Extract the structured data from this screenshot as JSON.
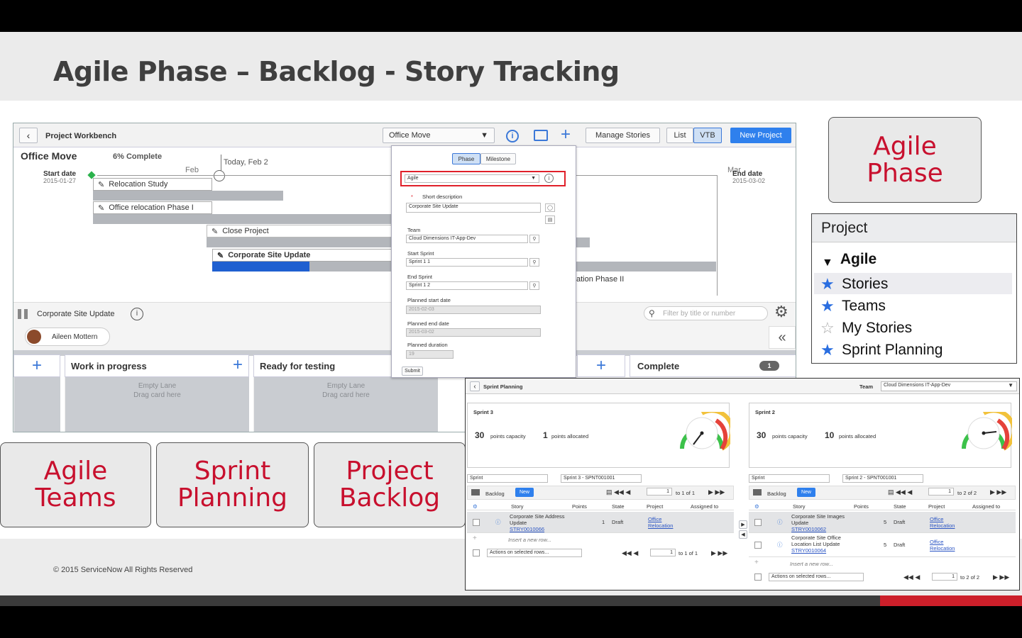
{
  "slide": {
    "title": "Agile Phase – Backlog - Story Tracking",
    "copyright": "© 2015 ServiceNow All Rights Reserved"
  },
  "workbench": {
    "header": "Project Workbench",
    "project_select": "Office Move",
    "buttons": {
      "manage": "Manage Stories",
      "list": "List",
      "vtb": "VTB",
      "new_project": "New Project"
    },
    "project_name": "Office Move",
    "complete": "6% Complete",
    "today": "Today, Feb 2",
    "month_feb": "Feb",
    "month_mar": "Mar",
    "start_label": "Start date",
    "start_value": "2015-01-27",
    "end_label": "End date",
    "end_value": "2015-03-02",
    "tasks": [
      "Relocation Study",
      "Office relocation Phase I",
      "Close Project",
      "Corporate Site Update"
    ],
    "phase2": "ation Phase II",
    "lane_header": "Corporate Site Update",
    "filter_placeholder": "Filter by title or number",
    "user": "Aileen Mottern",
    "lanes": {
      "wip": "Work in progress",
      "ready": "Ready for testing",
      "complete": "Complete",
      "complete_count": "1",
      "empty1": "Empty Lane",
      "empty2": "Drag card here"
    }
  },
  "form": {
    "tab_phase": "Phase",
    "tab_milestone": "Milestone",
    "phase_value": "Agile",
    "short_desc_label": "Short description",
    "short_desc": "Corporate Site Update",
    "team_label": "Team",
    "team": "Cloud Dimensions IT-App-Dev",
    "start_sprint_label": "Start Sprint",
    "start_sprint": "Sprint 1 1",
    "end_sprint_label": "End Sprint",
    "end_sprint": "Sprint 1 2",
    "planned_start_label": "Planned start date",
    "planned_start": "2015-02-03",
    "planned_end_label": "Planned end date",
    "planned_end": "2015-03-02",
    "planned_duration_label": "Planned duration",
    "planned_duration": "19",
    "submit": "Submit"
  },
  "boxes": {
    "agile_phase_1": "Agile",
    "agile_phase_2": "Phase",
    "agile_teams_1": "Agile",
    "agile_teams_2": "Teams",
    "sprint_planning_1": "Sprint",
    "sprint_planning_2": "Planning",
    "project_backlog_1": "Project",
    "project_backlog_2": "Backlog"
  },
  "nav": {
    "header": "Project",
    "group": "Agile",
    "items": [
      "Stories",
      "Teams",
      "My Stories",
      "Sprint Planning"
    ]
  },
  "sprint_planning": {
    "title": "Sprint Planning",
    "team_label": "Team",
    "team_value": "Cloud Dimensions IT-App-Dev",
    "sprints": [
      {
        "name": "Sprint 3",
        "capacity": "30",
        "capacity_label": "points capacity",
        "allocated": "1",
        "allocated_label": "points allocated",
        "filter1": "Sprint",
        "filter2": "Sprint 3 - SPNT001001",
        "backlog": "Backlog",
        "new": "New",
        "paging": "to 1 of 1",
        "page": "1",
        "columns": [
          "Story",
          "Points",
          "State",
          "Project",
          "Assigned to"
        ],
        "rows": [
          {
            "story": "Corporate Site Address Update",
            "number": "STRY0010066",
            "points": "1",
            "state": "Draft",
            "project": "Office Relocation"
          }
        ],
        "insert": "Insert a new row...",
        "actions": "Actions on selected rows...",
        "footer_paging": "to 1 of 1"
      },
      {
        "name": "Sprint 2",
        "capacity": "30",
        "capacity_label": "points capacity",
        "allocated": "10",
        "allocated_label": "points allocated",
        "filter1": "Sprint",
        "filter2": "Sprint 2 - SPNT001001",
        "backlog": "Backlog",
        "new": "New",
        "paging": "to 2 of 2",
        "page": "1",
        "columns": [
          "Story",
          "Points",
          "State",
          "Project",
          "Assigned to"
        ],
        "rows": [
          {
            "story": "Corporate Site Images Update",
            "number": "STRY0010062",
            "points": "5",
            "state": "Draft",
            "project": "Office Relocation"
          },
          {
            "story": "Corporate Site Office Location List Update",
            "number": "STRY0010064",
            "points": "5",
            "state": "Draft",
            "project": "Office Relocation"
          }
        ],
        "insert": "Insert a new row...",
        "actions": "Actions on selected rows...",
        "footer_paging": "to 2 of 2"
      }
    ]
  },
  "colors": {
    "accent_red": "#c8102e",
    "brand_blue": "#2a6ee0",
    "gantt_progress": "#1f5fd0"
  }
}
